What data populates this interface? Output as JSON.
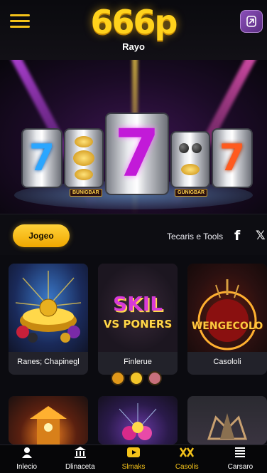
{
  "header": {
    "logo": "666p",
    "subtitle": "Rayo"
  },
  "hero": {
    "reel_labels": [
      "BUNIGBAR",
      "GUNIGBAR"
    ]
  },
  "bar": {
    "cta_label": "Jogeo",
    "tools_text": "Tecaris e Tools",
    "facebook_glyph": "f",
    "x_glyph": "𝕏"
  },
  "games": [
    {
      "caption": "Ranes; Chapinegl",
      "art_text": ""
    },
    {
      "caption": "Finlerue",
      "art_text": "SKIL",
      "art_text2": "VS PONERS"
    },
    {
      "caption": "Casololi",
      "art_text": "WENGECOLO"
    },
    {
      "caption": "",
      "art_text": ""
    },
    {
      "caption": "",
      "art_text": ""
    },
    {
      "caption": "",
      "art_text": ""
    }
  ],
  "pager": {
    "count": 3,
    "active": 1,
    "colors": [
      "#e0981a",
      "#f2c52a",
      "#c8707c"
    ]
  },
  "nav": {
    "items": [
      {
        "label": "Inlecio",
        "icon": "person-icon"
      },
      {
        "label": "Dlinaceta",
        "icon": "bank-icon"
      },
      {
        "label": "Slmaks",
        "icon": "play-icon"
      },
      {
        "label": "Casolis",
        "icon": "chips-icon"
      },
      {
        "label": "Carsaro",
        "icon": "list-icon"
      }
    ],
    "active_index": 2
  },
  "colors": {
    "accent": "#f4c21a",
    "background": "#0b0b10"
  }
}
